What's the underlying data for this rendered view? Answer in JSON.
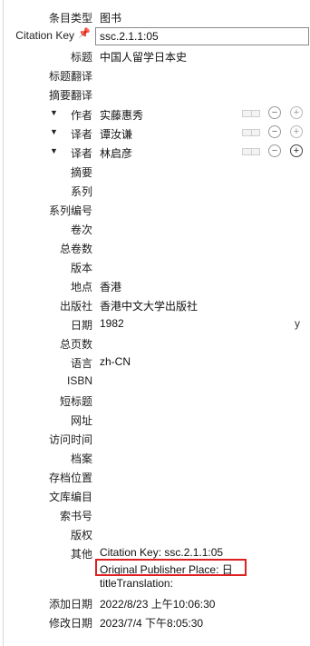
{
  "fields": {
    "item_type": {
      "label": "条目类型",
      "value": "图书"
    },
    "citation_key": {
      "label": "Citation Key",
      "value": "ssc.2.1.1:05"
    },
    "title": {
      "label": "标题",
      "value": "中国人留学日本史"
    },
    "title_translation": {
      "label": "标题翻译",
      "value": ""
    },
    "abstract_translation": {
      "label": "摘要翻译",
      "value": ""
    },
    "creators": [
      {
        "role": "作者",
        "name": "实藤惠秀"
      },
      {
        "role": "译者",
        "name": "谭汝谦"
      },
      {
        "role": "译者",
        "name": "林启彦"
      }
    ],
    "abstract": {
      "label": "摘要",
      "value": ""
    },
    "series": {
      "label": "系列",
      "value": ""
    },
    "series_number": {
      "label": "系列编号",
      "value": ""
    },
    "volume": {
      "label": "卷次",
      "value": ""
    },
    "num_volumes": {
      "label": "总卷数",
      "value": ""
    },
    "edition": {
      "label": "版本",
      "value": ""
    },
    "place": {
      "label": "地点",
      "value": "香港"
    },
    "publisher": {
      "label": "出版社",
      "value": "香港中文大学出版社"
    },
    "date": {
      "label": "日期",
      "value": "1982",
      "flag": "y"
    },
    "num_pages": {
      "label": "总页数",
      "value": ""
    },
    "language": {
      "label": "语言",
      "value": "zh-CN"
    },
    "isbn": {
      "label": "ISBN",
      "value": ""
    },
    "short_title": {
      "label": "短标题",
      "value": ""
    },
    "url": {
      "label": "网址",
      "value": ""
    },
    "access_date": {
      "label": "访问时间",
      "value": ""
    },
    "archive": {
      "label": "档案",
      "value": ""
    },
    "archive_location": {
      "label": "存档位置",
      "value": ""
    },
    "library_catalog": {
      "label": "文库编目",
      "value": ""
    },
    "call_number": {
      "label": "索书号",
      "value": ""
    },
    "rights": {
      "label": "版权",
      "value": ""
    },
    "extra": {
      "label": "其他",
      "lines": [
        "Citation Key: ssc.2.1.1:05",
        "Original Publisher Place: 日",
        "titleTranslation:"
      ]
    },
    "date_added": {
      "label": "添加日期",
      "value": "2022/8/23 上午10:06:30"
    },
    "date_modified": {
      "label": "修改日期",
      "value": "2023/7/4 下午8:05:30"
    }
  },
  "icons": {
    "pin": "pin-icon",
    "expand": "triangle-down-icon",
    "swap": "name-swap-icon",
    "minus": "minus-circle-icon",
    "plus": "plus-circle-icon"
  },
  "colors": {
    "highlight": "#e02020",
    "pin": "#d0232a"
  }
}
